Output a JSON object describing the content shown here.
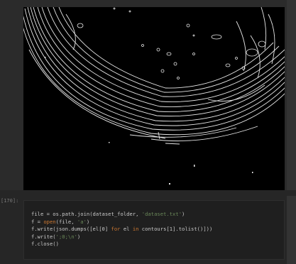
{
  "cell": {
    "prompt": "[170]:"
  },
  "image": {
    "description_icon": "edge-detection-output-image"
  },
  "code": {
    "line1_a": "file = os.path.join(dataset_folder, ",
    "line1_b": "'dataset.txt'",
    "line1_c": ")",
    "line2_a": "f = ",
    "line2_b": "open",
    "line2_c": "(file, ",
    "line2_d": "'a'",
    "line2_e": ")",
    "line3_a": "f.write(json.dumps([el[0] ",
    "line3_b": "for",
    "line3_c": " el ",
    "line3_d": "in",
    "line3_e": " contours[1].tolist()]))",
    "line4_a": "f.write(",
    "line4_b": "';0;\\n'",
    "line4_c": ")",
    "line5": "f.close()"
  },
  "colors": {
    "background": "#262626",
    "image_bg": "#000000",
    "keyword": "#cc7832",
    "string": "#6a8759"
  }
}
